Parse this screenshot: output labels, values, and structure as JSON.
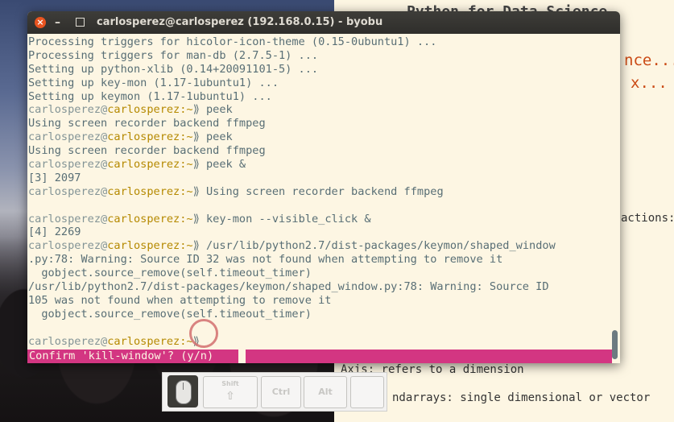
{
  "window": {
    "title": "carlosperez@carlosperez (192.168.0.15) - byobu",
    "close_glyph": "×"
  },
  "prompt": {
    "user": "carlosperez",
    "at": "@",
    "host": "carlosperez",
    "path": ":~",
    "sym": "⟫ "
  },
  "terminal_lines": [
    {
      "text": "Processing triggers for hicolor-icon-theme (0.15-0ubuntu1) ..."
    },
    {
      "text": "Processing triggers for man-db (2.7.5-1) ..."
    },
    {
      "text": "Setting up python-xlib (0.14+20091101-5) ..."
    },
    {
      "text": "Setting up key-mon (1.17-1ubuntu1) ..."
    },
    {
      "text": "Setting up keymon (1.17-1ubuntu1) ..."
    },
    {
      "cmd": "peek"
    },
    {
      "text": "Using screen recorder backend ffmpeg"
    },
    {
      "cmd": "peek"
    },
    {
      "text": "Using screen recorder backend ffmpeg"
    },
    {
      "cmd": "peek &"
    },
    {
      "text": "[3] 2097"
    },
    {
      "cmd": "Using screen recorder backend ffmpeg"
    },
    {
      "text": ""
    },
    {
      "cmd": "key-mon --visible_click &"
    },
    {
      "text": "[4] 2269"
    },
    {
      "cmd": "/usr/lib/python2.7/dist-packages/keymon/shaped_window"
    },
    {
      "text": ".py:78: Warning: Source ID 32 was not found when attempting to remove it"
    },
    {
      "text": "  gobject.source_remove(self.timeout_timer)"
    },
    {
      "text": "/usr/lib/python2.7/dist-packages/keymon/shaped_window.py:78: Warning: Source ID"
    },
    {
      "text": "105 was not found when attempting to remove it"
    },
    {
      "text": "  gobject.source_remove(self.timeout_timer)"
    },
    {
      "text": ""
    },
    {
      "cmd": ""
    }
  ],
  "status": {
    "confirm": "Confirm 'kill-window'? (y/n)"
  },
  "background_doc": {
    "title": "Python for Data Science",
    "orange1": "nce...",
    "orange2": "x...",
    "actions": "actions:",
    "axis": "Axis: refers to a dimension",
    "ndarrays": "ndarrays: single dimensional or vector"
  },
  "keymon": {
    "shift": "Shift",
    "ctrl": "Ctrl",
    "alt": "Alt",
    "arrow": "⇧"
  },
  "colors": {
    "statusbar": "#d33682",
    "terminal_bg": "#fdf6e3",
    "user": "#839496",
    "host": "#b58900",
    "close": "#e95420"
  }
}
